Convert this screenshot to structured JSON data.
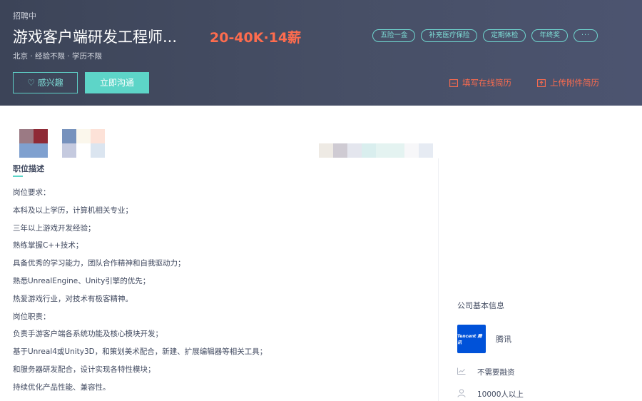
{
  "header": {
    "status": "招聘中",
    "title": "游戏客户端研发工程师...",
    "salary": "20-40K·14薪",
    "meta": "北京 · 经验不限 · 学历不限",
    "tags": [
      "五险一金",
      "补充医疗保险",
      "定期体检",
      "年终奖",
      "···"
    ],
    "interest_label": "感兴趣",
    "chat_label": "立即沟通",
    "fill_resume_label": "填写在线简历",
    "upload_resume_label": "上传附件简历",
    "colors": {
      "accent": "#5dd5c8",
      "salary": "#fe6c4e"
    }
  },
  "job": {
    "section_title": "职位描述",
    "lines": [
      "岗位要求：",
      "本科及以上学历，计算机相关专业；",
      "三年以上游戏开发经验；",
      "熟练掌握C++技术；",
      "具备优秀的学习能力，团队合作精神和自我驱动力；",
      "熟悉UnrealEngine、Unity引擎的优先；",
      "热爱游戏行业，对技术有极客精神。",
      "岗位职责：",
      "负责手游客户端各系统功能及核心模块开发；",
      "基于Unreal4或Unity3D，和策划美术配合，新建、扩展编辑器等相关工具；",
      "和服务器研发配合，设计实现各特性模块；",
      "持续优化产品性能、兼容性。"
    ]
  },
  "company": {
    "section_title": "公司基本信息",
    "logo_text": "Tencent 腾讯",
    "name": "腾讯",
    "finance": "不需要融资",
    "size": "10000人以上",
    "icons": [
      "chart-icon",
      "people-icon"
    ]
  }
}
